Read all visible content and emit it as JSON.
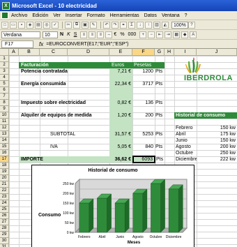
{
  "window": {
    "app_icon": "X",
    "title": "Microsoft Excel - 10 electricidad"
  },
  "menu": [
    "Archivo",
    "Edición",
    "Ver",
    "Insertar",
    "Formato",
    "Herramientas",
    "Datos",
    "Ventana",
    "?"
  ],
  "toolbar": {
    "zoom": "100%",
    "font": "Verdana",
    "size": "10",
    "bold": "N",
    "italic": "K",
    "underline": "S",
    "currency": "€",
    "percent": "%",
    "thousands": "000"
  },
  "formula_bar": {
    "cell": "F17",
    "fx": "fx",
    "formula": "=EUROCONVERT(E17;\"EUR\";\"ESP\")"
  },
  "columns": [
    "A",
    "B",
    "C",
    "D",
    "E",
    "F",
    "G",
    "H",
    "I",
    "J"
  ],
  "rows": [
    "1",
    "2",
    "3",
    "4",
    "5",
    "6",
    "7",
    "8",
    "9",
    "10",
    "11",
    "12",
    "13",
    "14",
    "15",
    "16",
    "17",
    "18",
    "19",
    "20",
    "21",
    "22",
    "23",
    "24",
    "25",
    "26",
    "27",
    "28",
    "29",
    "30",
    "31"
  ],
  "invoice": {
    "header": {
      "label": "Facturación",
      "euros": "Euros",
      "pesetas": "Pesetas"
    },
    "lines": [
      {
        "label": "Potencia contratada",
        "euros": "7,21 €",
        "pts": "1200",
        "unit": "Pts"
      },
      {
        "label": "Energía consumida",
        "euros": "22,34 €",
        "pts": "3717",
        "unit": "Pts"
      },
      {
        "label": "Impuesto sobre electricidad",
        "euros": "0,82 €",
        "pts": "136",
        "unit": "Pts"
      },
      {
        "label": "Alquiler de equipos de medida",
        "euros": "1,20 €",
        "pts": "200",
        "unit": "Pts"
      }
    ],
    "subtotal": {
      "label": "SUBTOTAL",
      "euros": "31,57 €",
      "pts": "5253",
      "unit": "Pts"
    },
    "iva": {
      "label": "IVA",
      "euros": "5,05 €",
      "pts": "840",
      "unit": "Pts"
    },
    "importe": {
      "label": "IMPORTE",
      "euros": "36,62 €",
      "pts": "6093",
      "unit": "Pts"
    }
  },
  "logo": {
    "text": "IBERDROLA"
  },
  "history": {
    "title": "Historial de consumo",
    "rows": [
      {
        "month": "Febrero",
        "value": "150 kw"
      },
      {
        "month": "Abril",
        "value": "175 kw"
      },
      {
        "month": "Junio",
        "value": "150 kw"
      },
      {
        "month": "Agosto",
        "value": "200 kw"
      },
      {
        "month": "Octubre",
        "value": "250 kw"
      },
      {
        "month": "Diciembre",
        "value": "222 kw"
      }
    ]
  },
  "chart_data": {
    "type": "bar",
    "title": "Historial de consumo",
    "xlabel": "Meses",
    "ylabel": "Consumo",
    "categories": [
      "Febrero",
      "Abril",
      "Junio",
      "Agosto",
      "Octubre",
      "Diciembre"
    ],
    "values": [
      150,
      175,
      150,
      200,
      250,
      222
    ],
    "yticks": [
      "0 kw",
      "50 kw",
      "100 kw",
      "150 kw",
      "200 kw",
      "250 kw"
    ],
    "ylim": [
      0,
      250
    ],
    "bar_color": "#2e8b3a"
  },
  "colors": {
    "accent": "#2e8b3a",
    "light": "#c3e3c3"
  }
}
